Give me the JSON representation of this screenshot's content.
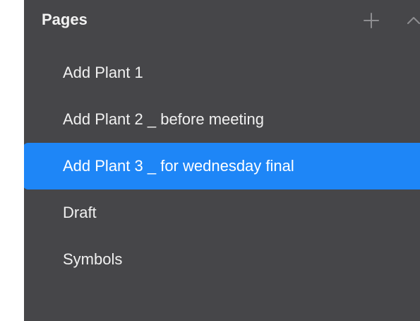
{
  "pages_panel": {
    "title": "Pages",
    "add_icon": "plus-icon",
    "collapse_icon": "chevron-up-icon",
    "items": [
      {
        "label": "Add Plant 1",
        "selected": false
      },
      {
        "label": "Add Plant 2 _ before meeting",
        "selected": false
      },
      {
        "label": "Add Plant 3 _ for wednesday final",
        "selected": true
      },
      {
        "label": "Draft",
        "selected": false
      },
      {
        "label": "Symbols",
        "selected": false
      }
    ]
  },
  "colors": {
    "panel_background": "#464649",
    "selection": "#1e86f7",
    "text": "#f1f1f1",
    "icon": "#8e8e91"
  }
}
